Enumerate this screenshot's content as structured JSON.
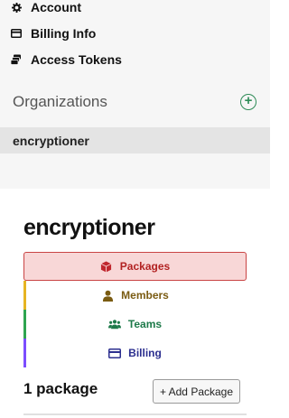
{
  "sidebar": {
    "links": [
      {
        "label": "Account",
        "icon": "gear-icon"
      },
      {
        "label": "Billing Info",
        "icon": "credit-card-icon"
      },
      {
        "label": "Access Tokens",
        "icon": "tokens-icon"
      }
    ],
    "organizations_heading": "Organizations",
    "add_org_label": "+",
    "organization": "encryptioner"
  },
  "main": {
    "org_title": "encryptioner",
    "tabs": [
      {
        "label": "Packages",
        "icon": "package-icon",
        "color": "#b22222"
      },
      {
        "label": "Members",
        "icon": "user-icon",
        "color": "#7a5b12"
      },
      {
        "label": "Teams",
        "icon": "users-icon",
        "color": "#1e7a4a"
      },
      {
        "label": "Billing",
        "icon": "credit-card-icon",
        "color": "#2c2f8f"
      }
    ],
    "rail_colors": [
      "#c94444",
      "#e6b422",
      "#2ea44f",
      "#7c4dff"
    ],
    "package_count": "1 package",
    "add_package_label": "+ Add Package"
  }
}
